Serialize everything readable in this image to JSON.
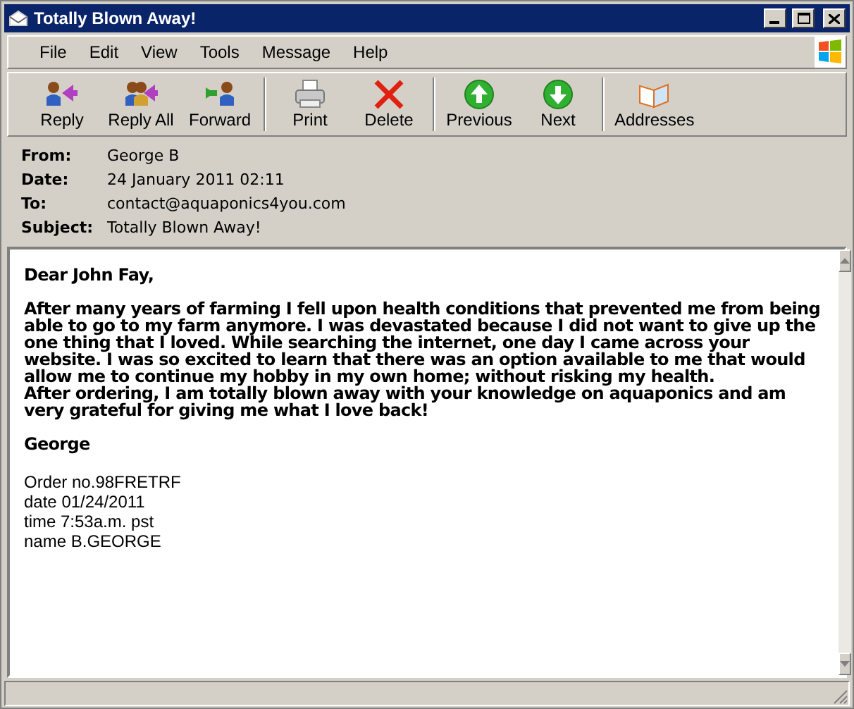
{
  "window": {
    "title": "Totally Blown Away!"
  },
  "menu": [
    "File",
    "Edit",
    "View",
    "Tools",
    "Message",
    "Help"
  ],
  "toolbar_groups": [
    [
      {
        "kind": "reply",
        "label": "Reply"
      },
      {
        "kind": "reply_all",
        "label": "Reply All"
      },
      {
        "kind": "forward",
        "label": "Forward"
      }
    ],
    [
      {
        "kind": "print",
        "label": "Print"
      },
      {
        "kind": "delete",
        "label": "Delete"
      }
    ],
    [
      {
        "kind": "previous",
        "label": "Previous"
      },
      {
        "kind": "next",
        "label": "Next"
      }
    ],
    [
      {
        "kind": "addresses",
        "label": "Addresses"
      }
    ]
  ],
  "headers": [
    {
      "label": "From:",
      "value": "George B"
    },
    {
      "label": "Date:",
      "value": "24 January 2011 02:11"
    },
    {
      "label": "To:",
      "value": "contact@aquaponics4you.com"
    },
    {
      "label": "Subject:",
      "value": "Totally Blown Away!"
    }
  ],
  "message": {
    "greeting": "Dear John Fay,",
    "paragraphs": [
      "After many years of farming I fell upon health conditions that prevented me from being able to go to my farm anymore. I was devastated because I did not want to give up the one thing that I loved. While searching the internet, one day I came across your website. I was so excited to learn that there was an option available to me that would allow me to continue my hobby in my own home; without risking my health.",
      "After ordering, I am totally blown away with your knowledge on aquaponics and am very grateful for giving me what I love back!"
    ],
    "signature": "George",
    "order_lines": [
      "Order no.98FRETRF",
      "date 01/24/2011",
      "time 7:53a.m. pst",
      "name B.GEORGE"
    ]
  }
}
